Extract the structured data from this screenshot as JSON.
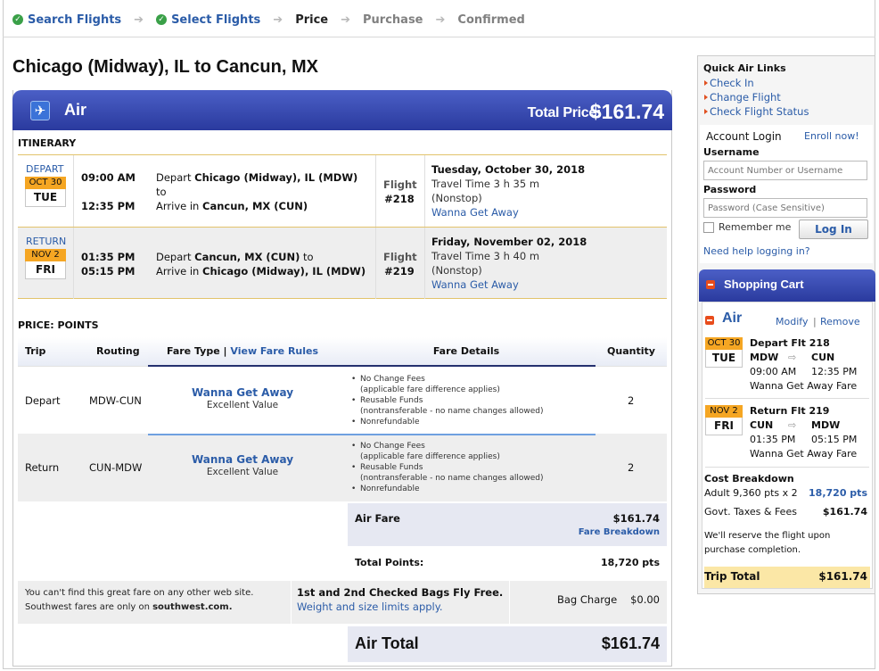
{
  "steps": [
    {
      "label": "Search Flights",
      "state": "done"
    },
    {
      "label": "Select Flights",
      "state": "done"
    },
    {
      "label": "Price",
      "state": "current"
    },
    {
      "label": "Purchase",
      "state": "todo"
    },
    {
      "label": "Confirmed",
      "state": "todo"
    }
  ],
  "page_title": "Chicago (Midway), IL to Cancun, MX",
  "air_header": {
    "label": "Air",
    "total_label": "Total Price:",
    "total_value": "$161.74"
  },
  "itinerary": {
    "heading": "ITINERARY",
    "depart": {
      "dir_label": "DEPART",
      "date": "OCT 30",
      "day": "TUE",
      "time1": "09:00 AM",
      "time2": "12:35 PM",
      "depart_prefix": "Depart",
      "depart_city": "Chicago (Midway), IL (MDW)",
      "to": "to",
      "arrive_prefix": "Arrive in",
      "arrive_city": "Cancun, MX (CUN)",
      "flight_label": "Flight",
      "flight_no": "#218",
      "date_full": "Tuesday, October 30, 2018",
      "travel_time": "Travel Time 3 h 35 m",
      "stops": "(Nonstop)",
      "fare": "Wanna Get Away"
    },
    "return": {
      "dir_label": "RETURN",
      "date": "NOV 2",
      "day": "FRI",
      "time1": "01:35 PM",
      "time2": "05:15 PM",
      "depart_prefix": "Depart",
      "depart_city": "Cancun, MX (CUN)",
      "to": "to",
      "arrive_prefix": "Arrive in",
      "arrive_city": "Chicago (Midway), IL (MDW)",
      "flight_label": "Flight",
      "flight_no": "#219",
      "date_full": "Friday, November 02, 2018",
      "travel_time": "Travel Time 3 h 40 m",
      "stops": "(Nonstop)",
      "fare": "Wanna Get Away"
    }
  },
  "price": {
    "heading": "PRICE: POINTS",
    "columns": {
      "trip": "Trip",
      "routing": "Routing",
      "fare_type": "Fare Type",
      "sep": "|",
      "view_rules": "View Fare Rules",
      "fare_details": "Fare Details",
      "quantity": "Quantity"
    },
    "rows": [
      {
        "trip": "Depart",
        "routing": "MDW-CUN",
        "fare_name": "Wanna Get Away",
        "fare_sub": "Excellent Value",
        "qty": "2"
      },
      {
        "trip": "Return",
        "routing": "CUN-MDW",
        "fare_name": "Wanna Get Away",
        "fare_sub": "Excellent Value",
        "qty": "2"
      }
    ],
    "fare_details": [
      "No Change Fees",
      "(applicable fare difference applies)",
      "Reusable Funds",
      "(nontransferable - no name changes allowed)",
      "Nonrefundable"
    ],
    "air_fare_label": "Air Fare",
    "air_fare_value": "$161.74",
    "breakdown_link": "Fare Breakdown",
    "total_points_label": "Total Points:",
    "total_points_value": "18,720 pts",
    "promo_line1": "You can't find this great fare on any other web site.",
    "promo_line2_prefix": "Southwest fares are only on",
    "promo_site": "southwest.com.",
    "bags_title": "1st and 2nd Checked Bags Fly Free.",
    "bags_link": "Weight and size limits apply.",
    "bag_charge_label": "Bag Charge",
    "bag_charge_value": "$0.00",
    "air_total_label": "Air Total",
    "air_total_value": "$161.74"
  },
  "sidebar": {
    "quick_links_title": "Quick Air Links",
    "quick_links": [
      "Check In",
      "Change Flight",
      "Check Flight Status"
    ],
    "login_title": "Account Login",
    "enroll": "Enroll now!",
    "username_label": "Username",
    "username_placeholder": "Account Number or Username",
    "password_label": "Password",
    "password_placeholder": "Password (Case Sensitive)",
    "remember": "Remember me",
    "login_button": "Log In",
    "help": "Need help logging in?"
  },
  "cart": {
    "title": "Shopping Cart",
    "air": "Air",
    "modify": "Modify",
    "sep": "|",
    "remove": "Remove",
    "depart": {
      "date": "OCT 30",
      "day": "TUE",
      "title": "Depart Flt 218",
      "from": "MDW",
      "to": "CUN",
      "dep": "09:00 AM",
      "arr": "12:35 PM",
      "fare": "Wanna Get Away Fare"
    },
    "return": {
      "date": "NOV 2",
      "day": "FRI",
      "title": "Return Flt 219",
      "from": "CUN",
      "to": "MDW",
      "dep": "01:35 PM",
      "arr": "05:15 PM",
      "fare": "Wanna Get Away Fare"
    },
    "cost_title": "Cost Breakdown",
    "adult_label": "Adult 9,360 pts x 2",
    "adult_value": "18,720 pts",
    "taxes_label": "Govt. Taxes & Fees",
    "taxes_value": "$161.74",
    "note": "We'll reserve the flight upon purchase completion.",
    "trip_total_label": "Trip Total",
    "trip_total_value": "$161.74"
  }
}
